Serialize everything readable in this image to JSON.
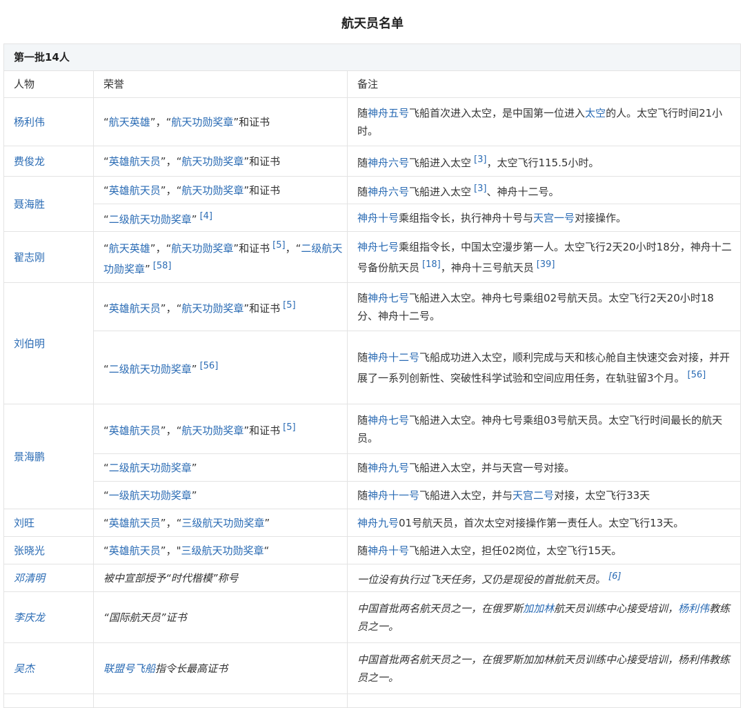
{
  "title": "航天员名单",
  "group": "第一批14人",
  "columns": [
    "人物",
    "荣誉",
    "备注"
  ],
  "names": {
    "yang": "杨利伟",
    "fei": "费俊龙",
    "nie": "聂海胜",
    "zhai": "翟志刚",
    "liu_bm": "刘伯明",
    "jing": "景海鹏",
    "liu_w": "刘旺",
    "zhang": "张晓光",
    "deng": "邓清明",
    "li": "李庆龙",
    "wu": "吴杰"
  },
  "t": {
    "q_open": "“",
    "q_close": "”",
    "q_mid": "”，“",
    "q_and_cert": "”和证书",
    "q_comma": "”，",
    "q_start_alt": "\"",
    "q_close_alt": "\"",
    "q_close_prime": "“",
    "hero_astro": "航天英雄",
    "merit_medal": "航天功勋奖章",
    "hero_astronaut": "英雄航天员",
    "second_merit": "二级航天功勋奖章",
    "first_merit": "一级航天功勋奖章",
    "third_merit": "三级航天功勋奖章",
    "er": "二",
    "ji_medal": "级航天功勋奖章",
    "sui": "随",
    "shenzhou5": "神舟五号",
    "shenzhou6": "神舟六号",
    "shenzhou7": "神舟七号",
    "shenzhou9": "神舟九号",
    "shenzhou10": "神舟十号",
    "shenzhou11": "神舟十一号",
    "shenzhou12": "神舟十二号",
    "tiangong1": "天宫一号",
    "tiangong2": "天宫二号",
    "taikong": "太空",
    "yang_liwei": "杨利伟",
    "gagarin": "加加林",
    "soyuz": "联盟号飞船"
  },
  "refs": {
    "r3": "[3]",
    "r4": "[4]",
    "r5": "[5]",
    "r58": "[58]",
    "r18": "[18]",
    "r39": "[39]",
    "r56": "[56]",
    "r6": "[6]"
  },
  "text": {
    "yang_note_a": "飞船首次进入太空，是中国第一位进入",
    "yang_note_b": "的人。太空飞行时间21小时。",
    "fei_note_a": "飞船进入太空",
    "fei_note_b": "，太空飞行115.5小时。",
    "nie_note1_b": "、神舟十二号。",
    "nie_note2_a": "乘组指令长，执行神舟十号与",
    "nie_note2_b": "对接操作。",
    "zhai_note_a": "乘组指令长，中国太空漫步第一人。太空飞行2天20小时18分，神舟十二号备份航天员",
    "zhai_note_b": "，神舟十三号航天员",
    "lbm_note1": "飞船进入太空。神舟七号乘组02号航天员。太空飞行2天20小时18分、神舟十二号。",
    "lbm_note2": "飞船成功进入太空，顺利完成与天和核心舱自主快速交会对接，并开展了一系列创新性、突破性科学试验和空间应用任务，在轨驻留3个月。",
    "jhp_note1": "飞船进入太空。神舟七号乘组03号航天员。太空飞行时间最长的航天员。",
    "jhp_note2": "飞船进入太空，并与天宫一号对接。",
    "jhp_note3_a": "飞船进入太空，并与",
    "jhp_note3_b": "对接，太空飞行33天",
    "lw_note": "01号航天员，首次太空对接操作第一责任人。太空飞行13天。",
    "zxg_note": "飞船进入太空，担任02岗位，太空飞行15天。",
    "deng_honor": "被中宣部授予“时代楷模”称号",
    "deng_note": "一位没有执行过飞天任务，又仍是现役的首批航天员。",
    "li_honor": "“国际航天员”证书",
    "li_note_a": "中国首批两名航天员之一，在俄罗斯",
    "li_note_b": "航天员训练中心接受培训，",
    "li_note_c": "教练员之一。",
    "wu_honor_b": "指令长最高证书",
    "wu_note": "中国首批两名航天员之一，在俄罗斯加加林航天员训练中心接受培训，杨利伟教练员之一。"
  }
}
